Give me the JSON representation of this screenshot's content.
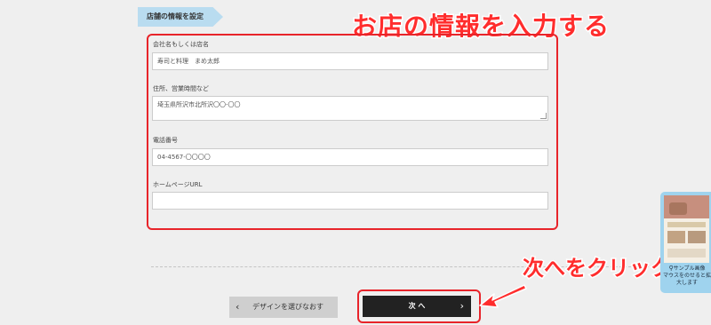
{
  "section": {
    "tag": "店舗の情報を設定"
  },
  "annotations": {
    "title": "お店の情報を入力する",
    "click_hint": "次へをクリック",
    "color": "#ff2d2d"
  },
  "form": {
    "company": {
      "label": "会社名もしくは店名",
      "value": "寿司と料理　まめ太郎"
    },
    "address": {
      "label": "住所、営業時間など",
      "value": "埼玉県所沢市北所沢〇〇-〇〇"
    },
    "phone": {
      "label": "電話番号",
      "value": "04-4567-〇〇〇〇"
    },
    "homepage": {
      "label": "ホームページURL",
      "value": ""
    }
  },
  "buttons": {
    "back_label": "デザインを選びなおす",
    "back_icon": "chevron-left",
    "next_label": "次 へ",
    "next_icon": "chevron-right"
  },
  "sample_widget": {
    "line1": "サンプル画像",
    "line2": "マウスをのせると拡",
    "line3": "大します",
    "icon": "magnifier",
    "bg": "#9fd3ee"
  }
}
